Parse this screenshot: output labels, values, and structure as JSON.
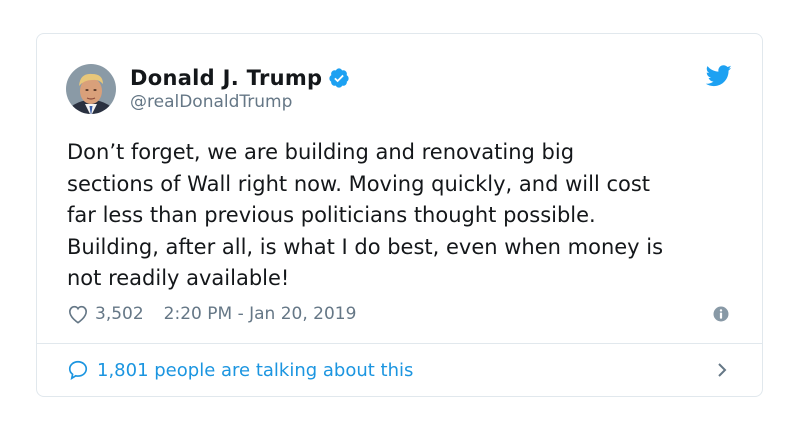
{
  "author": {
    "display_name": "Donald J. Trump",
    "handle": "@realDonaldTrump",
    "verified": true,
    "avatar_icon": "profile-photo"
  },
  "tweet": {
    "text": "Don’t forget, we are building and renovating big\nsections of Wall right now. Moving quickly, and will cost\nfar less than previous politicians thought possible.\nBuilding, after all, is what I do best, even when money is\nnot readily available!",
    "likes": "3,502",
    "timestamp": "2:20 PM - Jan 20, 2019"
  },
  "footer": {
    "talking_label": "1,801 people are talking about this"
  },
  "icons": {
    "brand": "twitter-bird-icon",
    "verified": "verified-badge-icon",
    "like": "heart-icon",
    "info": "info-icon",
    "reply": "speech-bubble-icon",
    "more": "chevron-right-icon"
  },
  "colors": {
    "brand_blue": "#1da1f2",
    "link_blue": "#1b95e0",
    "text": "#14171a",
    "secondary_text": "#657786",
    "border": "#e1e8ed"
  }
}
